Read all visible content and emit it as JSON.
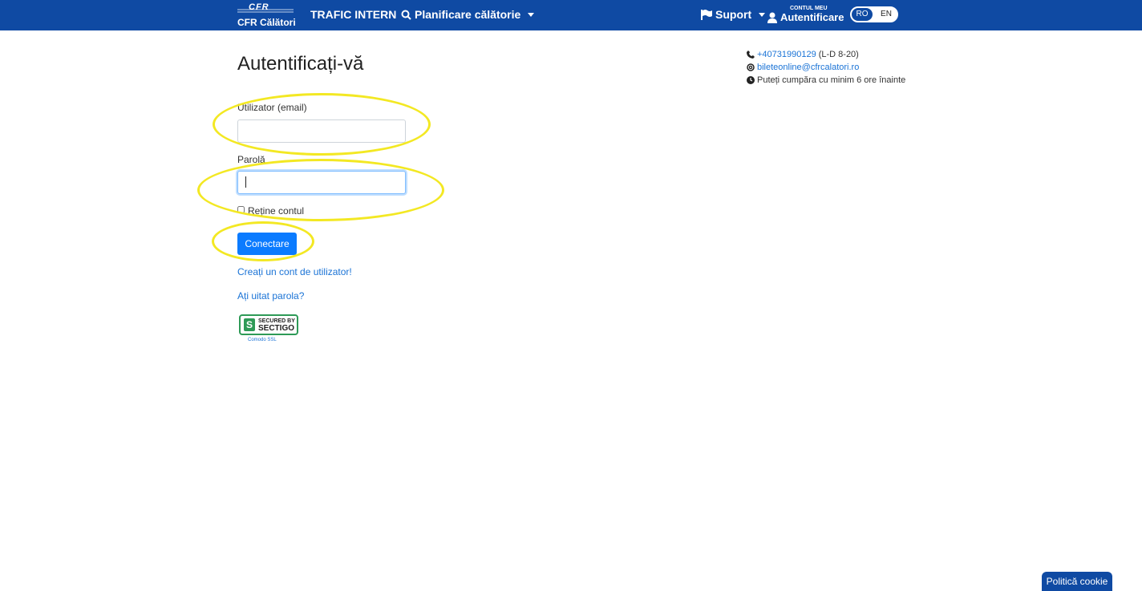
{
  "nav": {
    "logo_top": "CFR",
    "logo_name": "CFR Călători",
    "trafic": "TRAFIC INTERN",
    "planificare": "Planificare călătorie",
    "suport": "Suport",
    "account_small": "CONTUL MEU",
    "account_big": "Autentificare",
    "lang_ro": "RO",
    "lang_en": "EN"
  },
  "page": {
    "title": "Autentificați-vă",
    "user_label": "Utilizator (email)",
    "user_value": "",
    "pass_label": "Parolă",
    "pass_value": "",
    "remember_label": "Reține contul",
    "submit": "Conectare",
    "create_account": "Creați un cont de utilizator!",
    "forgot_password": "Ați uitat parola?"
  },
  "badge": {
    "secured_by": "SECURED BY",
    "sectigo": "SECTIGO",
    "comodo": "Comodo SSL"
  },
  "contact": {
    "phone": "+40731990129",
    "hours": "(L-D 8-20)",
    "email": "bileteonline@cfrcalatori.ro",
    "note": "Puteți cumpăra cu minim 6 ore înainte"
  },
  "cookie": {
    "label": "Politică cookie"
  },
  "colors": {
    "navbar": "#0f4aa3",
    "primary": "#0b7bff",
    "highlight": "#f3e823"
  }
}
